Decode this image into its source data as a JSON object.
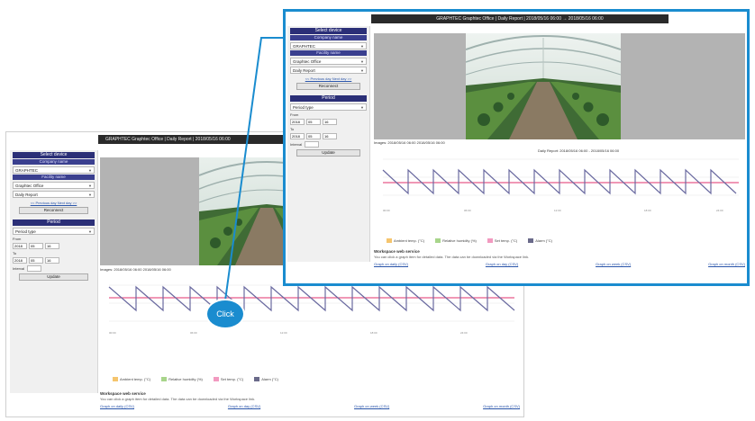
{
  "app": {
    "window_title": "GRAPHTEC Graphtec Office | Daily Report | 2018/05/16 06:00 → 2018/05/16 06:00",
    "back_window_title": "GRAPHTEC Graphtec Office | Daily Report | 2018/05/16 06:00"
  },
  "sidebar": {
    "select_device": "Select device",
    "company_name_label": "Company name",
    "company_value": "GRAPHTEC",
    "facility_name_label": "Facility name",
    "facility_value": "Graphtec Office",
    "report_value": "Daily Report",
    "links": "<< Previous day  Next day >>",
    "reconnect_button": "Reconnect",
    "period_label": "Period",
    "period_type": "Period type",
    "from_label": "From",
    "to_label": "To",
    "from_val_1": "2018",
    "from_val_2": "05",
    "from_val_3": "16",
    "to_val_1": "2018",
    "to_val_2": "05",
    "to_val_3": "16",
    "interval_label": "Interval",
    "update_button": "Update"
  },
  "image": {
    "caption": "Images: 2018/05/16 06:00  2018/05/16 06:00"
  },
  "chart": {
    "title": "Daily Report: 2018/05/16 06:00 - 2018/05/16 06:00"
  },
  "legend": {
    "items": [
      {
        "label": "Ambient temp. (°C)",
        "color": "#f5c56e"
      },
      {
        "label": "Relative humidity (%)",
        "color": "#a8d58b"
      },
      {
        "label": "Set temp. (°C)",
        "color": "#f29ac0"
      },
      {
        "label": "Alarm (°C)",
        "color": "#6a6a8a"
      }
    ]
  },
  "footer": {
    "title": "Workspace web service",
    "description": "You can click a graph item for detailed data. The data can be downloaded via the Workspace link.",
    "links": [
      "Graph on daily (CSV)",
      "Graph on day (CSV)",
      "Graph on week (CSV)",
      "Graph on month (CSV)"
    ]
  },
  "callout": {
    "click_label": "Click"
  },
  "colors": {
    "accent": "#1a8ccf",
    "sidebar_header": "#2b2f77",
    "series_line": "#6a6aa0",
    "threshold_line": "#e85a8a"
  }
}
